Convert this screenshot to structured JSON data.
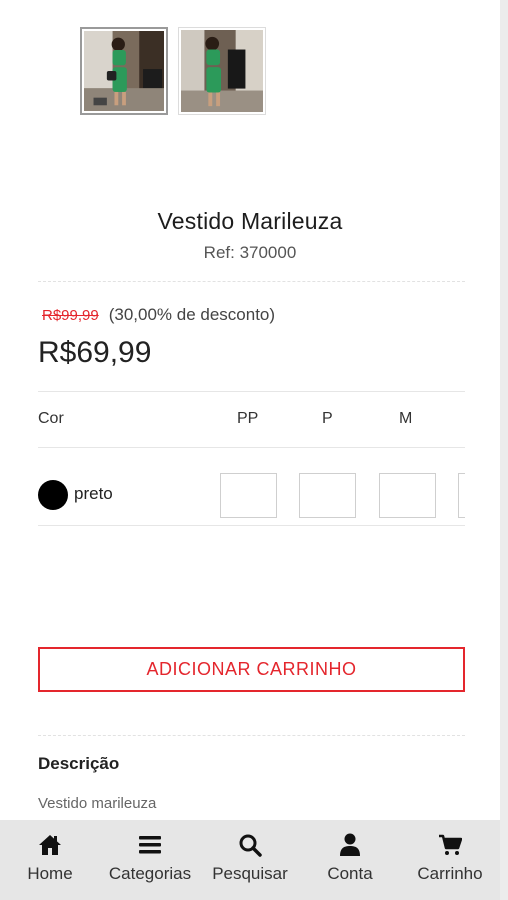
{
  "product": {
    "title": "Vestido Marileuza",
    "ref": "Ref: 370000",
    "old_price": "R$99,99",
    "discount": "(30,00% de desconto)",
    "price": "R$69,99"
  },
  "variants": {
    "color_header": "Cor",
    "sizes": [
      "PP",
      "P",
      "M"
    ],
    "rows": [
      {
        "color_name": "preto",
        "swatch_color": "#000000"
      }
    ]
  },
  "actions": {
    "add_to_cart": "ADICIONAR CARRINHO"
  },
  "description": {
    "title": "Descrição",
    "text": "Vestido marileuza"
  },
  "nav": {
    "items": [
      {
        "label": "Home",
        "icon": "home-icon"
      },
      {
        "label": "Categorias",
        "icon": "menu-icon"
      },
      {
        "label": "Pesquisar",
        "icon": "search-icon"
      },
      {
        "label": "Conta",
        "icon": "user-icon"
      },
      {
        "label": "Carrinho",
        "icon": "cart-icon"
      }
    ]
  },
  "colors": {
    "accent": "#e4262d",
    "nav_background": "#e6e6e6"
  }
}
